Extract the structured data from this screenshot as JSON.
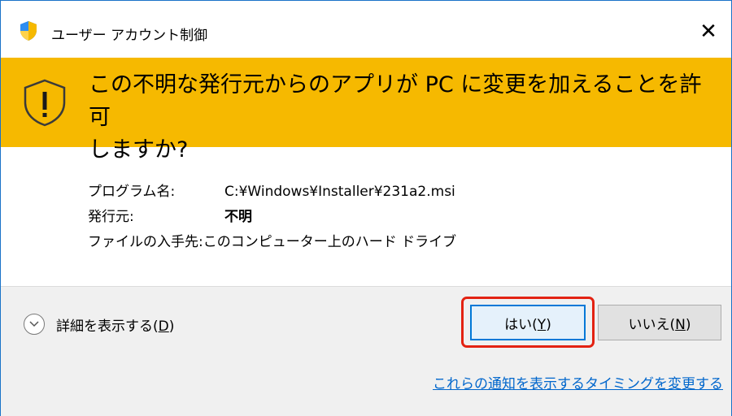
{
  "title_bar": {
    "title": "ユーザー アカウント制御",
    "icon": "uac-shield-icon",
    "close_glyph": "✕"
  },
  "banner": {
    "line1": "この不明な発行元からのアプリが PC に変更を加えることを許可",
    "line2": "しますか?",
    "icon": "warning-shield-icon",
    "color": "#f6b900"
  },
  "details": [
    {
      "label": "プログラム名:",
      "value": "C:¥Windows¥Installer¥231a2.msi"
    },
    {
      "label": "発行元:",
      "value": "不明"
    },
    {
      "label": "ファイルの入手先:",
      "value": "このコンピューター上のハード ドライブ"
    }
  ],
  "footer": {
    "show_details": "詳細を表示する(",
    "show_details_key": "D",
    "show_details_end": ")",
    "yes_label": "はい(",
    "yes_key": "Y",
    "yes_end": ")",
    "no_label": "いいえ(",
    "no_key": "N",
    "no_end": ")",
    "link": "これらの通知を表示するタイミングを変更する",
    "highlight_color": "#e32212"
  }
}
